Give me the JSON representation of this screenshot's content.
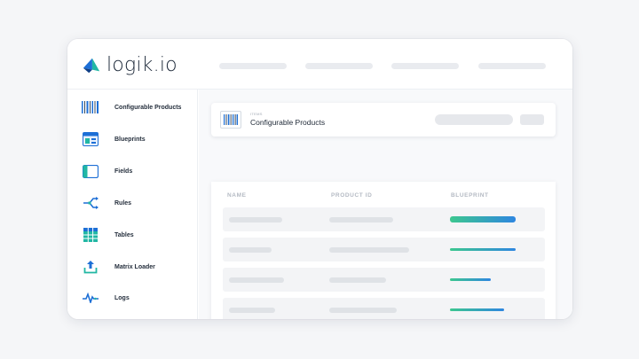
{
  "app": {
    "logo_text": "logik.io",
    "brand_colors": {
      "blue": "#1d6fd6",
      "teal": "#21b7a4",
      "gradient_start": "#3cc78f",
      "gradient_end": "#2e86e0"
    }
  },
  "sidebar": {
    "items": [
      {
        "label": "Configurable Products",
        "icon": "barcode-icon"
      },
      {
        "label": "Blueprints",
        "icon": "blueprint-icon"
      },
      {
        "label": "Fields",
        "icon": "field-icon"
      },
      {
        "label": "Rules",
        "icon": "rules-icon"
      },
      {
        "label": "Tables",
        "icon": "table-icon"
      },
      {
        "label": "Matrix Loader",
        "icon": "upload-icon"
      },
      {
        "label": "Logs",
        "icon": "pulse-icon"
      }
    ]
  },
  "header": {
    "small_label": "ITEMS",
    "title": "Configurable Products"
  },
  "table": {
    "columns": [
      "NAME",
      "PRODUCT ID",
      "BLUEPRINT"
    ],
    "blueprint_progress": [
      1.0,
      1.0,
      0.62,
      0.82
    ]
  }
}
